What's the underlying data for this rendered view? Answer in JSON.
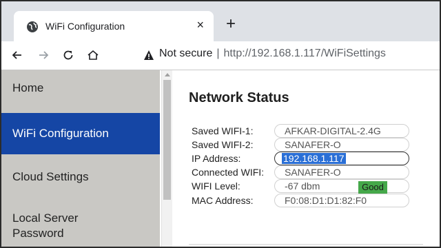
{
  "browser": {
    "tab_title": "WiFi Configuration",
    "close_glyph": "×",
    "new_tab_glyph": "+",
    "security_icon": "warning-icon",
    "security_label": "Not secure",
    "separator": "|",
    "url": "http://192.168.1.117/WiFiSettings"
  },
  "sidebar": {
    "items": [
      {
        "label": "Home"
      },
      {
        "label": "WiFi Configuration"
      },
      {
        "label": "Cloud Settings"
      },
      {
        "label": "Local Server Password"
      }
    ],
    "active_index": 1
  },
  "network_status": {
    "title": "Network Status",
    "rows": [
      {
        "label": "Saved WIFI-1:",
        "value": "AFKAR-DIGITAL-2.4G"
      },
      {
        "label": "Saved WIFI-2:",
        "value": "SANAFER-O"
      },
      {
        "label": "IP Address:",
        "value": "192.168.1.117"
      },
      {
        "label": "Connected WIFI:",
        "value": "SANAFER-O"
      },
      {
        "label": "WIFI Level:",
        "value": "-67 dbm"
      },
      {
        "label": "MAC Address:",
        "value": "F0:08:D1:D1:82:F0"
      }
    ],
    "wifi_quality": "Good"
  },
  "colors": {
    "sidebar_bg": "#c9c8c4",
    "active_nav_bg": "#1546a5",
    "good_badge": "#45a84a",
    "selection": "#2a6fd6"
  }
}
